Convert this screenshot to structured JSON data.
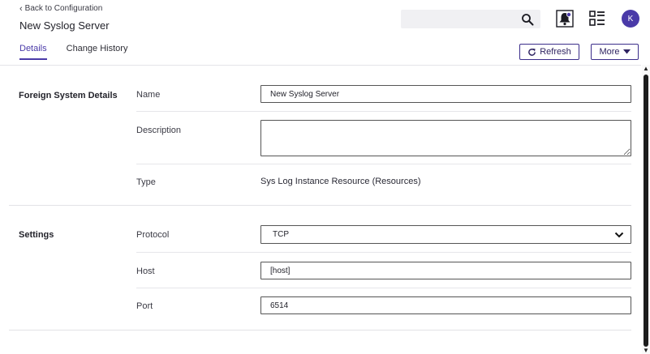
{
  "header": {
    "back_link": "Back to Configuration",
    "title": "New Syslog Server"
  },
  "search": {
    "placeholder": "",
    "value": ""
  },
  "user": {
    "avatar_initial": "K"
  },
  "tabs": [
    {
      "label": "Details",
      "active": true
    },
    {
      "label": "Change History",
      "active": false
    }
  ],
  "actions": {
    "refresh_label": "Refresh",
    "more_label": "More"
  },
  "sections": {
    "foreign_system": {
      "label": "Foreign System Details",
      "name_label": "Name",
      "name_value": "New Syslog Server",
      "description_label": "Description",
      "description_value": "",
      "type_label": "Type",
      "type_value": "Sys Log Instance Resource (Resources)"
    },
    "settings": {
      "label": "Settings",
      "protocol_label": "Protocol",
      "protocol_value": "TCP",
      "host_label": "Host",
      "host_value": "[host]",
      "port_label": "Port",
      "port_value": "6514"
    }
  },
  "colors": {
    "accent": "#4a3aa8",
    "button_border": "#3b2d8a"
  }
}
